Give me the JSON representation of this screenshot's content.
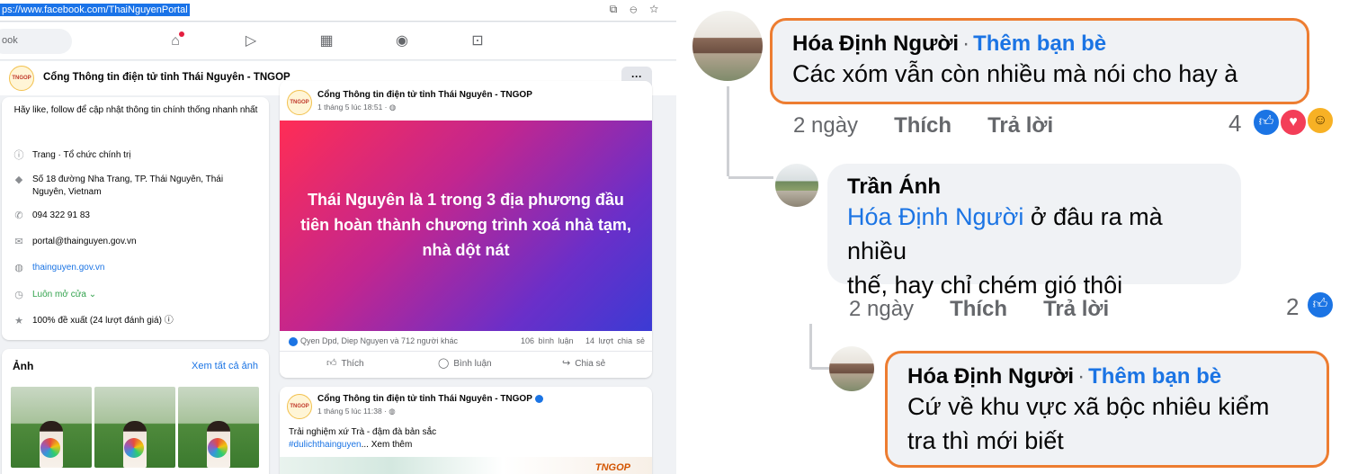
{
  "browser": {
    "url": "ps://www.facebook.com/ThaiNguyenPortal"
  },
  "fb_nav": {
    "search_placeholder": "ook",
    "items": [
      "home-icon",
      "video-icon",
      "marketplace-icon",
      "groups-icon",
      "gaming-icon"
    ]
  },
  "page": {
    "logo_text": "TNGOP",
    "name": "Cổng Thông tin điện tử tỉnh Thái Nguyên - TNGOP",
    "more_label": "···"
  },
  "intro": {
    "text": "Hãy like, follow để cập nhật thông tin chính thống nhanh nhất",
    "rows": [
      {
        "icon": "info-icon",
        "text": "Trang · Tổ chức chính trị",
        "bold": "Trang"
      },
      {
        "icon": "location-icon",
        "text": "Số 18 đường Nha Trang, TP. Thái Nguyên, Thái Nguyên, Vietnam"
      },
      {
        "icon": "phone-icon",
        "text": "094 322 91 83"
      },
      {
        "icon": "email-icon",
        "text": "portal@thainguyen.gov.vn"
      },
      {
        "icon": "globe-icon",
        "text": "thainguyen.gov.vn"
      },
      {
        "icon": "clock-icon",
        "text": "Luôn mở cửa"
      },
      {
        "icon": "star-icon",
        "text": "100% đề xuất (24 lượt đánh giá)"
      }
    ]
  },
  "photos": {
    "title": "Ảnh",
    "see_all": "Xem tất cả ảnh"
  },
  "post1": {
    "author": "Cổng Thông tin điện tử tỉnh Thái Nguyên - TNGOP",
    "time": "1 tháng 5 lúc 18:51 · ",
    "banner_text": "Thái Nguyên là 1 trong 3 địa phương đầu tiên hoàn thành chương trình xoá nhà tạm, nhà dột nát",
    "reactions": "Qyen Dpd, Diep Nguyen và 712 người khác",
    "comments": "106 bình luận",
    "shares": "14 lượt chia sẻ",
    "like": "Thích",
    "comment": "Bình luận",
    "share": "Chia sẻ"
  },
  "post2": {
    "author": "Cổng Thông tin điện tử tỉnh Thái Nguyên - TNGOP",
    "time": "1 tháng 5 lúc 11:38 · ",
    "line1": "Trải nghiệm xứ Trà - đậm đà bản sắc",
    "hashtag": "#dulichthainguyen",
    "see_more": "... Xem thêm",
    "watermark": "TNGOP"
  },
  "comments": [
    {
      "author": "Hóa Định Người",
      "add_friend": "Thêm bạn bè",
      "text": "Các xóm vẫn còn nhiều mà nói cho hay à",
      "time": "2 ngày",
      "like": "Thích",
      "reply": "Trả lời",
      "reaction_count": "4"
    },
    {
      "author": "Trần Ánh",
      "mention": "Hóa Định Người",
      "text_l1": " ở đâu ra mà nhiều",
      "text_l2": "thế, hay chỉ chém gió thôi",
      "time": "2 ngày",
      "like": "Thích",
      "reply": "Trả lời",
      "reaction_count": "2"
    },
    {
      "author": "Hóa Định Người",
      "add_friend": "Thêm bạn bè",
      "text_l1": "Cứ về khu vực xã bộc nhiêu kiểm",
      "text_l2": "tra thì mới biết"
    }
  ],
  "colors": {
    "fb_blue": "#1b74e4",
    "highlight": "#ed7d31",
    "bubble_bg": "#f0f2f5"
  }
}
